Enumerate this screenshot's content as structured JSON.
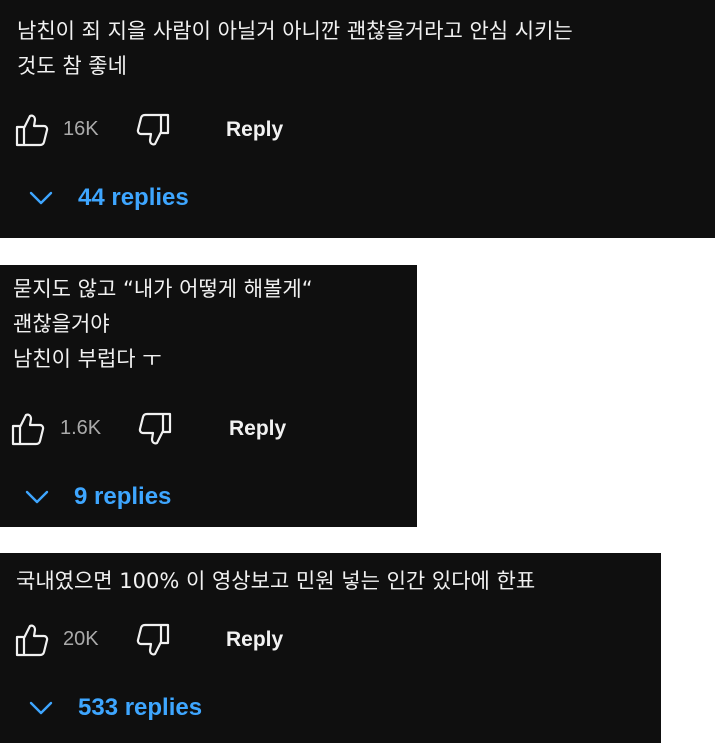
{
  "comments": [
    {
      "text_lines": [
        "남친이 죄 지을 사람이 아닐거 아니깐 괜찮을거라고 안심 시키는",
        "것도 참 좋네"
      ],
      "likes": "16K",
      "reply_label": "Reply",
      "replies_label": "44 replies"
    },
    {
      "text_lines": [
        "묻지도 않고 “내가 어떻게 해볼게“",
        "괜찮을거야",
        "남친이 부럽다 ㅜ"
      ],
      "likes": "1.6K",
      "reply_label": "Reply",
      "replies_label": "9 replies"
    },
    {
      "text_lines": [
        "국내였으면 100% 이 영상보고 민원 넣는 인간 있다에 한표"
      ],
      "likes": "20K",
      "reply_label": "Reply",
      "replies_label": "533 replies"
    }
  ],
  "colors": {
    "card_bg": "#0f0f0f",
    "text": "#f1f1f1",
    "muted": "#aaaaaa",
    "link": "#3ea6ff"
  },
  "icons": [
    "thumb-up-icon",
    "thumb-down-icon",
    "chevron-down-icon"
  ]
}
